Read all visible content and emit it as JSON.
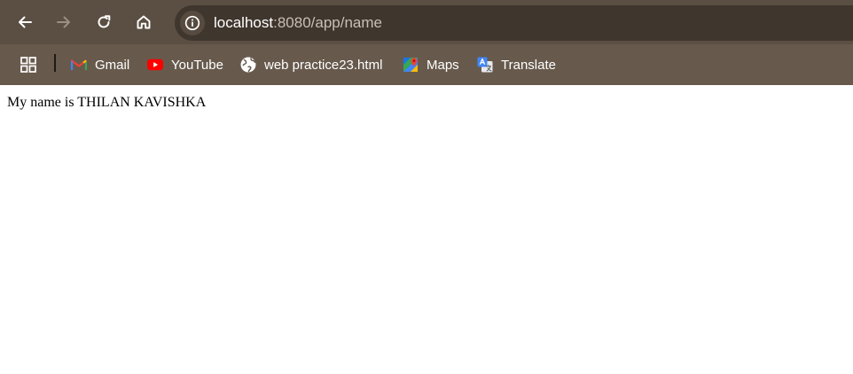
{
  "toolbar": {
    "url_host": "localhost",
    "url_rest": ":8080/app/name"
  },
  "bookmarks": [
    {
      "label": "Gmail",
      "icon": "gmail-icon"
    },
    {
      "label": "YouTube",
      "icon": "youtube-icon"
    },
    {
      "label": "web practice23.html",
      "icon": "globe-icon"
    },
    {
      "label": "Maps",
      "icon": "maps-icon"
    },
    {
      "label": "Translate",
      "icon": "translate-icon"
    }
  ],
  "page": {
    "text": "My name is THILAN KAVISHKA"
  },
  "colors": {
    "toolbar_bg": "#5b4f43",
    "bookmarks_bg": "#675a4d",
    "omnibox_bg": "#3f362e",
    "page_bg": "#ffffff"
  }
}
